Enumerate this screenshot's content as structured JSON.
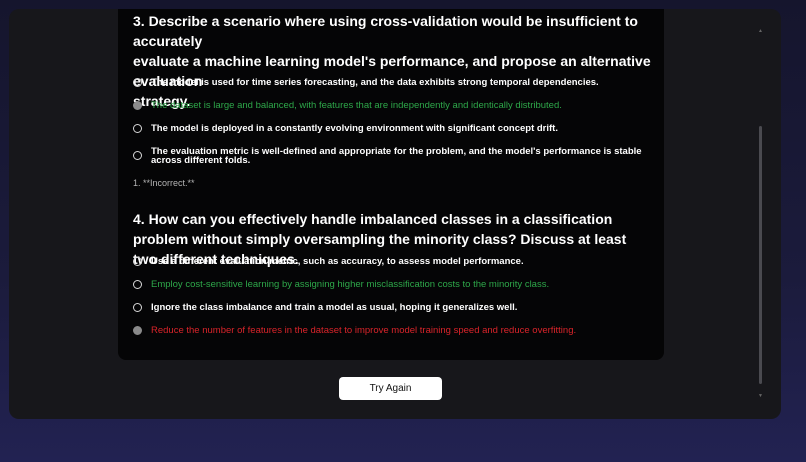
{
  "quiz": {
    "q3_line1_partial": "3. Describe a scenario where using cross-validation would be insufficient to accurately",
    "q3_line2": "evaluate a machine learning model's performance, and propose an alternative evaluation",
    "q3_line3": "strategy.",
    "q3_options": [
      "The model is used for time series forecasting, and the data exhibits strong temporal dependencies.",
      "The dataset is large and balanced, with features that are independently and identically distributed.",
      "The model is deployed in a constantly evolving environment with significant concept drift.",
      "The evaluation metric is well-defined and appropriate for the problem, and the model's performance is stable across different folds."
    ],
    "q3_feedback": "1. **Incorrect.**",
    "q4_title": "4. How can you effectively handle imbalanced classes in a classification problem without simply oversampling the minority class? Discuss at least two different techniques.",
    "q4_options": [
      "Use a different evaluation metric, such as accuracy, to assess model performance.",
      "Employ cost-sensitive learning by assigning higher misclassification costs to the minority class.",
      "Ignore the class imbalance and train a model as usual, hoping it generalizes well.",
      "Reduce the number of features in the dataset to improve model training speed and reduce overfitting."
    ]
  },
  "actions": {
    "try_again": "Try Again"
  },
  "colors": {
    "correct": "#2ea84a",
    "incorrect": "#d9242a",
    "card_bg": "#050506",
    "modal_bg": "#17171b"
  }
}
